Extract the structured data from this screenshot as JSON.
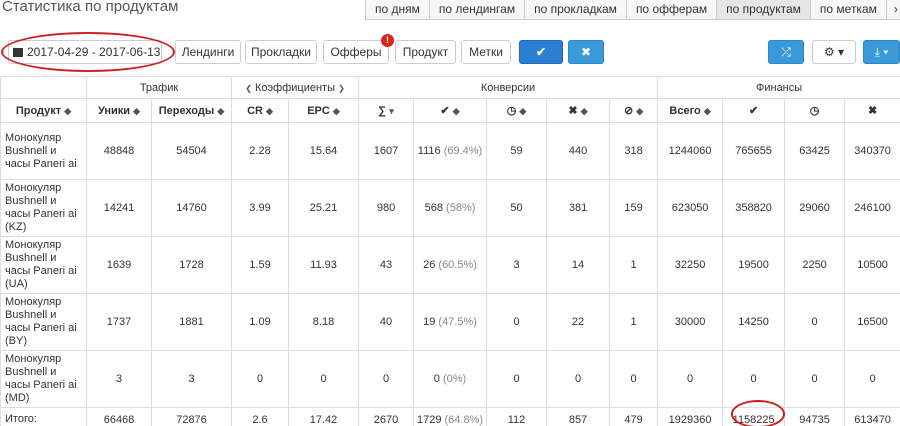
{
  "page": {
    "title": "Статистика по продуктам"
  },
  "tabs": [
    {
      "label": "по дням",
      "active": false
    },
    {
      "label": "по лендингам",
      "active": false
    },
    {
      "label": "по прокладкам",
      "active": false
    },
    {
      "label": "по офферам",
      "active": false
    },
    {
      "label": "по продуктам",
      "active": true
    },
    {
      "label": "по меткам",
      "active": false
    },
    {
      "label": "›",
      "active": false
    }
  ],
  "toolbar": {
    "date_range": "2017-04-29 - 2017-06-13",
    "landings": "Лендинги",
    "prelands": "Прокладки",
    "offers": "Офферы",
    "offers_badge": "!",
    "product": "Продукт",
    "tags": "Метки",
    "apply_icon": "✔",
    "reset_icon": "✖",
    "shuffle_icon": "⤮",
    "settings_icon": "⚙ ▾",
    "download_icon": "⤓ ▾"
  },
  "groups": {
    "traffic": "Трафик",
    "coefficients": "Коэффициенты",
    "coef_prev": "❮",
    "coef_next": "❯",
    "conversions": "Конверсии",
    "finance": "Финансы"
  },
  "columns": {
    "product": "Продукт",
    "uniques": "Уники",
    "clicks": "Переходы",
    "cr": "CR",
    "epc": "EPC",
    "sum": "∑",
    "approved": "✔",
    "hold": "◷",
    "rejected": "✖",
    "trash": "⊘",
    "total": "Всего",
    "fin_approved": "✔",
    "fin_hold": "◷",
    "fin_rejected": "✖"
  },
  "rows": [
    {
      "product": "Монокуляр Bushnell и часы Paneri ai",
      "uniques": "48848",
      "clicks": "54504",
      "cr": "2.28",
      "epc": "15.64",
      "sum": "1607",
      "approved": "1116",
      "approved_pct": "(69.4%)",
      "hold": "59",
      "rejected": "440",
      "trash": "318",
      "total": "1244060",
      "fin_approved": "765655",
      "fin_hold": "63425",
      "fin_rejected": "340370"
    },
    {
      "product": "Монокуляр Bushnell и часы Paneri ai (KZ)",
      "uniques": "14241",
      "clicks": "14760",
      "cr": "3.99",
      "epc": "25.21",
      "sum": "980",
      "approved": "568",
      "approved_pct": "(58%)",
      "hold": "50",
      "rejected": "381",
      "trash": "159",
      "total": "623050",
      "fin_approved": "358820",
      "fin_hold": "29060",
      "fin_rejected": "246100"
    },
    {
      "product": "Монокуляр Bushnell и часы Paneri ai (UA)",
      "uniques": "1639",
      "clicks": "1728",
      "cr": "1.59",
      "epc": "11.93",
      "sum": "43",
      "approved": "26",
      "approved_pct": "(60.5%)",
      "hold": "3",
      "rejected": "14",
      "trash": "1",
      "total": "32250",
      "fin_approved": "19500",
      "fin_hold": "2250",
      "fin_rejected": "10500"
    },
    {
      "product": "Монокуляр Bushnell и часы Paneri ai (BY)",
      "uniques": "1737",
      "clicks": "1881",
      "cr": "1.09",
      "epc": "8.18",
      "sum": "40",
      "approved": "19",
      "approved_pct": "(47.5%)",
      "hold": "0",
      "rejected": "22",
      "trash": "1",
      "total": "30000",
      "fin_approved": "14250",
      "fin_hold": "0",
      "fin_rejected": "16500"
    },
    {
      "product": "Монокуляр Bushnell и часы Paneri ai (MD)",
      "uniques": "3",
      "clicks": "3",
      "cr": "0",
      "epc": "0",
      "sum": "0",
      "approved": "0",
      "approved_pct": "(0%)",
      "hold": "0",
      "rejected": "0",
      "trash": "0",
      "total": "0",
      "fin_approved": "0",
      "fin_hold": "0",
      "fin_rejected": "0"
    }
  ],
  "totals": {
    "label": "Итого:",
    "uniques": "66468",
    "clicks": "72876",
    "cr": "2.6",
    "epc": "17.42",
    "sum": "2670",
    "approved": "1729",
    "approved_pct": "(64.8%)",
    "hold": "112",
    "rejected": "857",
    "trash": "479",
    "total": "1929360",
    "fin_approved": "1158225",
    "fin_hold": "94735",
    "fin_rejected": "613470"
  },
  "colors": {
    "primary": "#2a7fd4",
    "info": "#3a9ad9",
    "annotation": "#cc1f1f",
    "badge": "#d9261c"
  }
}
